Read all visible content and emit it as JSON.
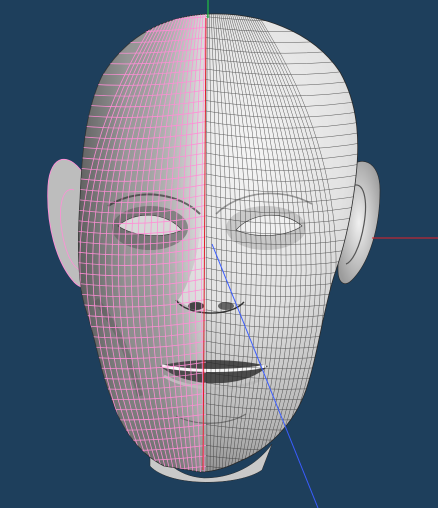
{
  "viewport": {
    "background_color": "#1e3f5c",
    "object": "head-mesh",
    "mirror_mode": "left-half-selected-wireframe"
  },
  "colors": {
    "mesh_fill": "#e4e4e4",
    "mesh_shadow": "#9a9a9a",
    "mesh_deep_shadow": "#4a4a4a",
    "wire": "#2a2a2a",
    "selection_wire": "#ff8fd6",
    "x_axis": "#e0202a",
    "y_axis": "#20c040",
    "z_axis": "#3a5cff"
  },
  "gizmo": {
    "axes": [
      "x-axis",
      "y-axis",
      "z-axis"
    ]
  }
}
